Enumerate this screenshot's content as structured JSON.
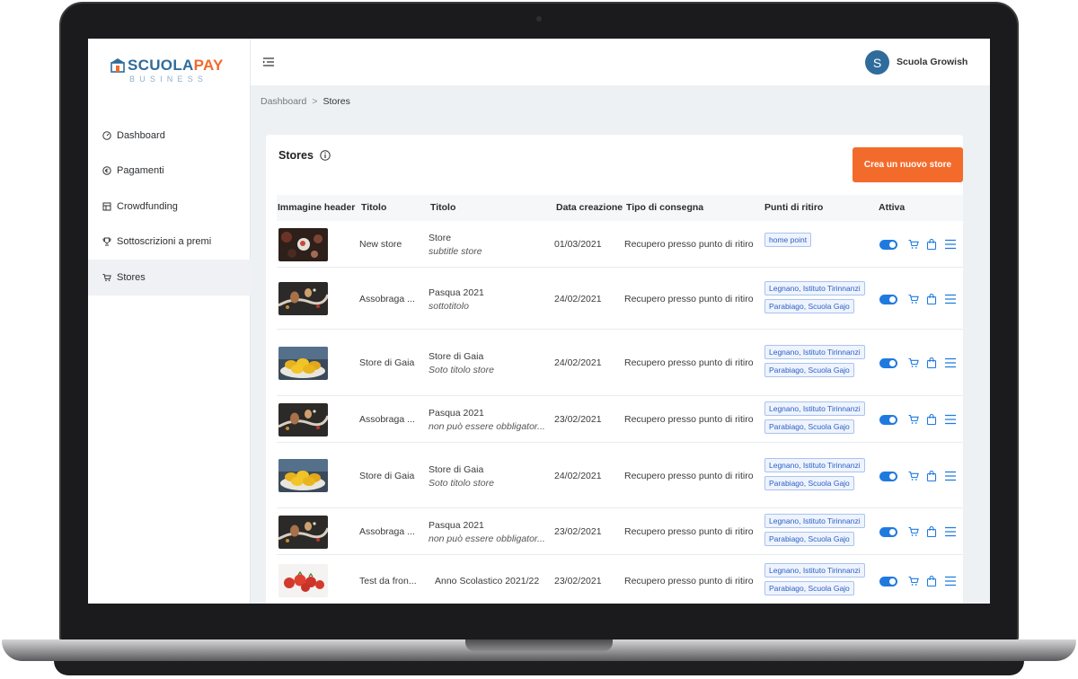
{
  "brand": {
    "name_part1": "SCUOLA",
    "name_part2": "PAY",
    "tagline": "BUSINESS"
  },
  "user": {
    "initial": "S",
    "name": "Scuola Growish"
  },
  "sidebar": {
    "items": [
      {
        "label": "Dashboard",
        "icon": "gauge-icon"
      },
      {
        "label": "Pagamenti",
        "icon": "euro-icon"
      },
      {
        "label": "Crowdfunding",
        "icon": "grid-icon"
      },
      {
        "label": "Sottoscrizioni a premi",
        "icon": "trophy-icon"
      },
      {
        "label": "Stores",
        "icon": "cart-icon",
        "active": true
      }
    ]
  },
  "breadcrumb": {
    "root": "Dashboard",
    "separator": ">",
    "current": "Stores"
  },
  "page": {
    "title": "Stores",
    "create_button": "Crea un nuovo store"
  },
  "table": {
    "headers": [
      "Immagine header",
      "Titolo",
      "Titolo",
      "Data creazione",
      "Tipo di consegna",
      "Punti di ritiro",
      "Attiva"
    ],
    "rows": [
      {
        "image": "flowers",
        "name": "New store",
        "title": "Store",
        "subtitle": "subtitle store",
        "date": "01/03/2021",
        "delivery": "Recupero presso punto di ritiro",
        "points": [
          "home point"
        ],
        "active": true
      },
      {
        "image": "eggs",
        "name": "Assobraga ...",
        "title": "Pasqua 2021",
        "subtitle": "sottotitolo",
        "date": "24/02/2021",
        "delivery": "Recupero presso punto di ritiro",
        "points": [
          "Legnano, Istituto Tirinnanzi",
          "Parabiago, Scuola Gajo"
        ],
        "active": true
      },
      {
        "image": "lemons",
        "name": "Store di Gaia",
        "title": "Store di Gaia",
        "subtitle": "Soto titolo store",
        "date": "24/02/2021",
        "delivery": "Recupero presso punto di ritiro",
        "points": [
          "Legnano, Istituto Tirinnanzi",
          "Parabiago, Scuola Gajo"
        ],
        "active": true
      },
      {
        "image": "eggs",
        "name": "Assobraga ...",
        "title": "Pasqua 2021",
        "subtitle": "non può essere obbligator...",
        "date": "23/02/2021",
        "delivery": "Recupero presso punto di ritiro",
        "points": [
          "Legnano, Istituto Tirinnanzi",
          "Parabiago, Scuola Gajo"
        ],
        "active": true
      },
      {
        "image": "lemons",
        "name": "Store di Gaia",
        "title": "Store di Gaia",
        "subtitle": "Soto titolo store",
        "date": "24/02/2021",
        "delivery": "Recupero presso punto di ritiro",
        "points": [
          "Legnano, Istituto Tirinnanzi",
          "Parabiago, Scuola Gajo"
        ],
        "active": true
      },
      {
        "image": "eggs",
        "name": "Assobraga ...",
        "title": "Pasqua 2021",
        "subtitle": "non può essere obbligator...",
        "date": "23/02/2021",
        "delivery": "Recupero presso punto di ritiro",
        "points": [
          "Legnano, Istituto Tirinnanzi",
          "Parabiago, Scuola Gajo"
        ],
        "active": true
      },
      {
        "image": "tomatoes",
        "name": "Test da fron...",
        "title": "Anno Scolastico 2021/22",
        "subtitle": "",
        "date": "23/02/2021",
        "delivery": "Recupero presso punto di ritiro",
        "points": [
          "Legnano, Istituto Tirinnanzi",
          "Parabiago, Scuola Gajo"
        ],
        "active": true
      }
    ]
  },
  "colors": {
    "accent": "#f36b2b",
    "primary": "#2f6c9b",
    "toggle": "#1f7ae0",
    "action": "#1f7ae0"
  }
}
